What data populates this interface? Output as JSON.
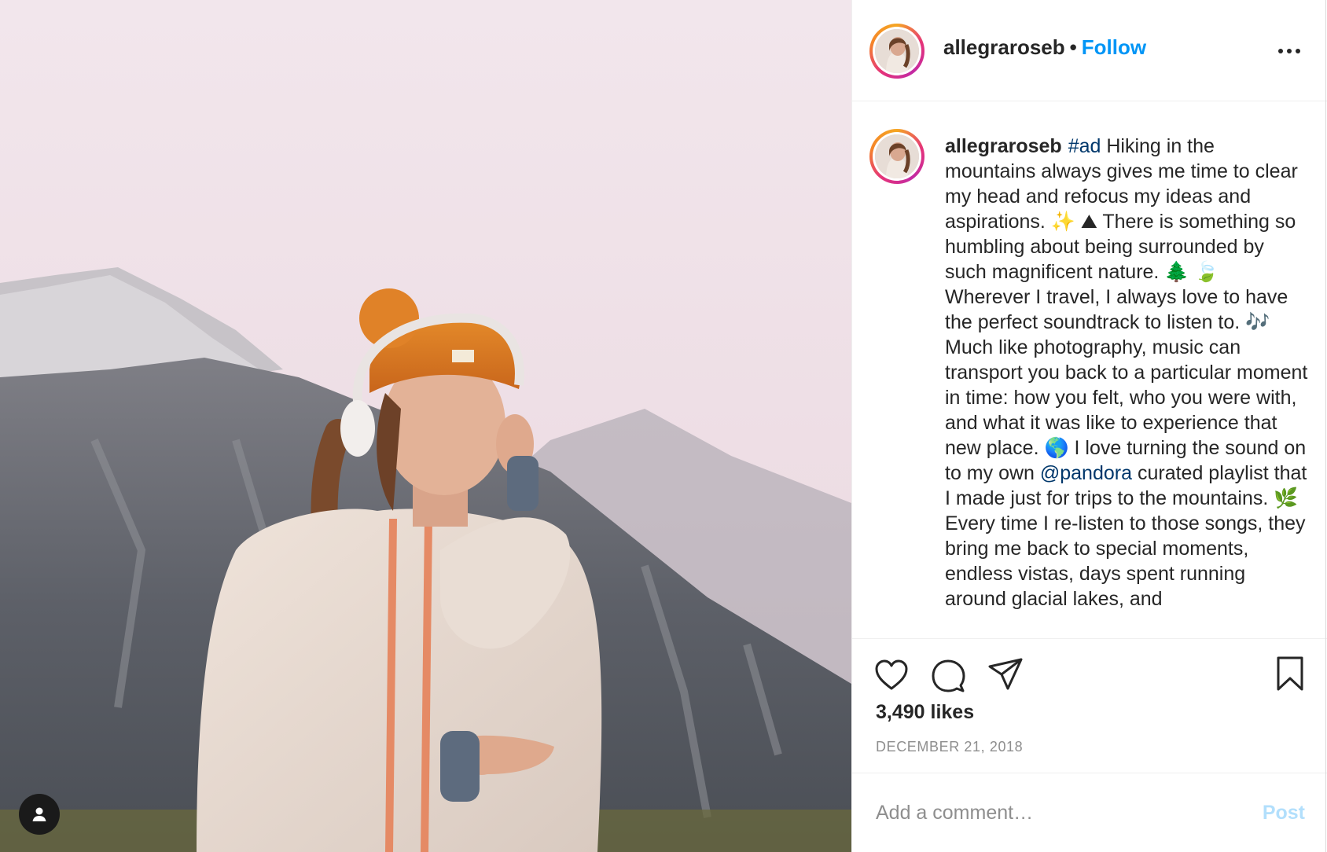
{
  "post": {
    "username": "allegraroseb",
    "separator": "•",
    "follow_label": "Follow",
    "caption_hashtag": "#ad",
    "caption_part1": " Hiking in the mountains always gives me time to clear my head and refocus my ideas and aspirations. ✨ ⛰  There is something so humbling about being surrounded by such magnificent nature. 🌲 🍃  Wherever I travel, I always love to have the perfect soundtrack to listen to. 🎶  Much like photography, music can transport you back to a particular moment in time: how you felt, who you were with, and what it was like to experience that new place. 🌎  I love turning the sound on to my own ",
    "caption_mention": "@pandora",
    "caption_part2": " curated playlist that I made just for trips to the mountains. 🌿  Every time I re-listen to those songs, they bring me back to special moments, endless vistas, days spent running around glacial lakes, and",
    "likes": "3,490 likes",
    "date": "DECEMBER 21, 2018"
  },
  "comment": {
    "placeholder": "Add a comment…",
    "post_label": "Post"
  },
  "icons": {
    "like": "heart-icon",
    "comment": "comment-bubble-icon",
    "share": "paper-plane-icon",
    "save": "bookmark-icon",
    "more": "more-dots-icon",
    "tagged": "user-tag-icon"
  },
  "colors": {
    "follow": "#0095f6",
    "link": "#00376b",
    "post_disabled": "#b2dffc",
    "meta": "#8e8e8e"
  }
}
